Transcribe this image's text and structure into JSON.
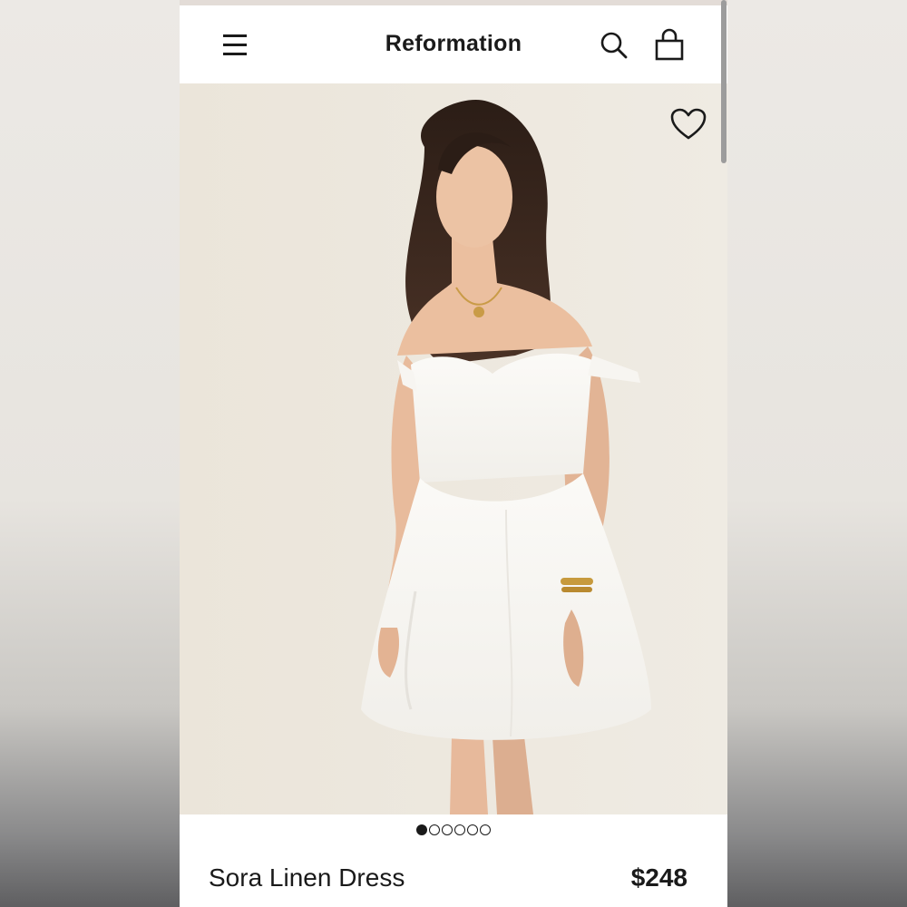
{
  "header": {
    "brand": "Reformation",
    "menu_icon": "hamburger-menu-icon",
    "search_icon": "search-icon",
    "bag_icon": "shopping-bag-icon"
  },
  "product": {
    "image_alt": "Model wearing white off-shoulder mini dress",
    "wishlist_icon": "heart-icon",
    "name": "Sora Linen Dress",
    "price": "$248",
    "carousel": {
      "total": 6,
      "active_index": 0
    }
  },
  "colors": {
    "text": "#1a1a1a",
    "background": "#ffffff",
    "image_backdrop": "#ece6dc"
  }
}
